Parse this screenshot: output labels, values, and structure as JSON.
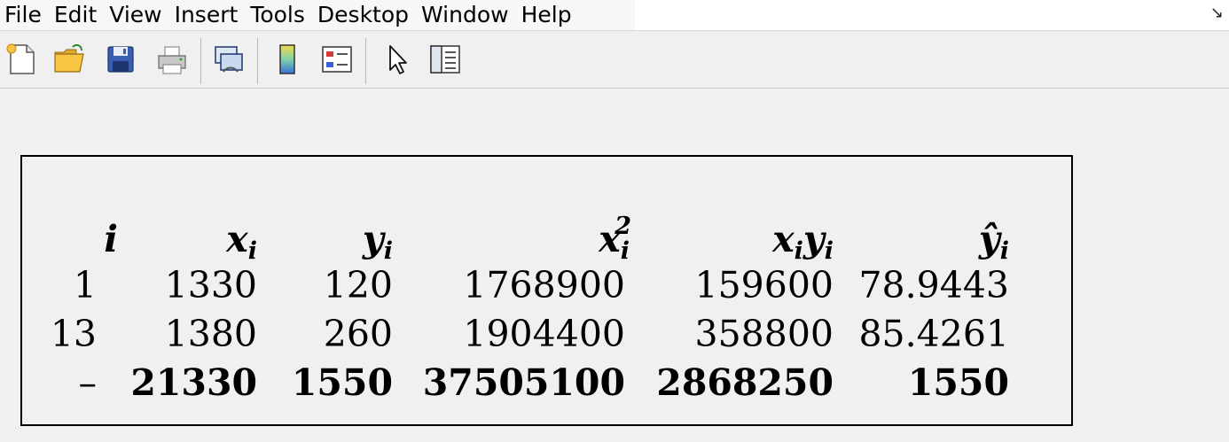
{
  "menu": [
    "File",
    "Edit",
    "View",
    "Insert",
    "Tools",
    "Desktop",
    "Window",
    "Help"
  ],
  "toolbar": {
    "buttons": [
      {
        "name": "new-figure-icon"
      },
      {
        "name": "open-file-icon"
      },
      {
        "name": "save-icon"
      },
      {
        "name": "print-icon"
      },
      {
        "name": "link-plot-icon"
      },
      {
        "name": "colorbar-icon"
      },
      {
        "name": "legend-icon"
      },
      {
        "name": "edit-plot-arrow-icon"
      },
      {
        "name": "property-inspector-icon"
      }
    ]
  },
  "table": {
    "headers": [
      {
        "base": "i",
        "sub": "",
        "sup": ""
      },
      {
        "base": "x",
        "sub": "i",
        "sup": ""
      },
      {
        "base": "y",
        "sub": "i",
        "sup": ""
      },
      {
        "base": "x",
        "sub": "i",
        "sup": "2"
      },
      {
        "base": "x",
        "sub": "i",
        "base2": "y",
        "sub2": "i"
      },
      {
        "base": "ŷ",
        "sub": "i",
        "sup": ""
      }
    ],
    "rows": [
      [
        "1",
        "1330",
        "120",
        "1768900",
        "159600",
        "78.9443"
      ],
      [
        "13",
        "1380",
        "260",
        "1904400",
        "358800",
        "85.4261"
      ]
    ],
    "totals": [
      "–",
      "21330",
      "1550",
      "37505100",
      "2868250",
      "1550"
    ]
  }
}
